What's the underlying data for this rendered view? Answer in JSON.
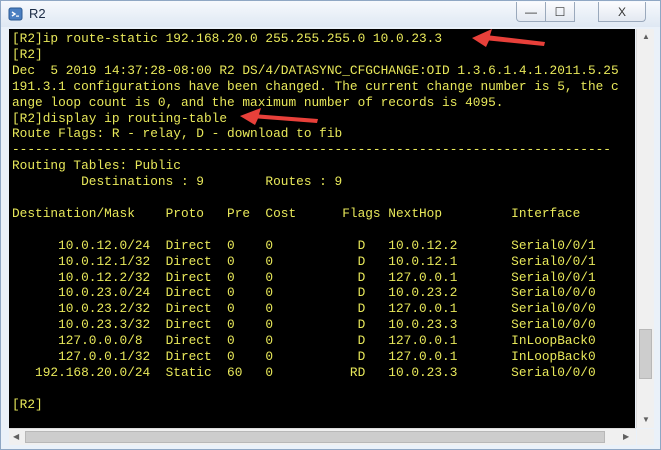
{
  "window": {
    "title": "R2",
    "minimize_glyph": "—",
    "maximize_glyph": "☐",
    "close_glyph": "X"
  },
  "colors": {
    "terminal_bg": "#000000",
    "terminal_text": "#e8e85a",
    "annotation_arrow": "#e8403a"
  },
  "terminal": {
    "lines": [
      "[R2]ip route-static 192.168.20.0 255.255.255.0 10.0.23.3",
      "[R2]",
      "Dec  5 2019 14:37:28-08:00 R2 DS/4/DATASYNC_CFGCHANGE:OID 1.3.6.1.4.1.2011.5.25",
      "191.3.1 configurations have been changed. The current change number is 5, the c",
      "ange loop count is 0, and the maximum number of records is 4095.",
      "[R2]display ip routing-table",
      "Route Flags: R - relay, D - download to fib",
      "------------------------------------------------------------------------------",
      "Routing Tables: Public",
      "         Destinations : 9        Routes : 9",
      "",
      "Destination/Mask    Proto   Pre  Cost      Flags NextHop         Interface",
      "",
      "      10.0.12.0/24  Direct  0    0           D   10.0.12.2       Serial0/0/1",
      "      10.0.12.1/32  Direct  0    0           D   10.0.12.1       Serial0/0/1",
      "      10.0.12.2/32  Direct  0    0           D   127.0.0.1       Serial0/0/1",
      "      10.0.23.0/24  Direct  0    0           D   10.0.23.2       Serial0/0/0",
      "      10.0.23.2/32  Direct  0    0           D   127.0.0.1       Serial0/0/0",
      "      10.0.23.3/32  Direct  0    0           D   10.0.23.3       Serial0/0/0",
      "      127.0.0.0/8   Direct  0    0           D   127.0.0.1       InLoopBack0",
      "      127.0.0.1/32  Direct  0    0           D   127.0.0.1       InLoopBack0",
      "   192.168.20.0/24  Static  60   0          RD   10.0.23.3       Serial0/0/0",
      "",
      "[R2]"
    ]
  }
}
